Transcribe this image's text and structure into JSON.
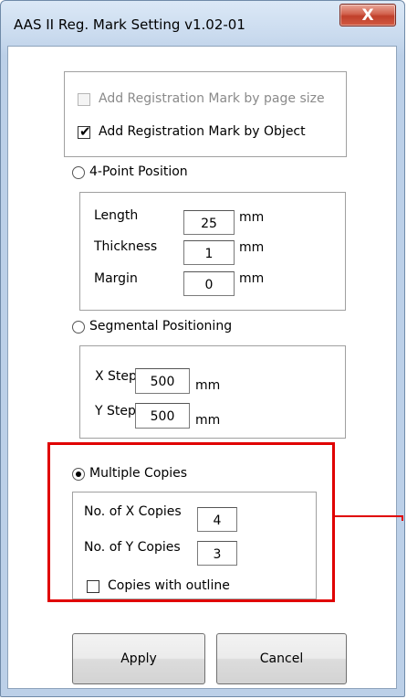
{
  "window": {
    "title": "AAS II Reg. Mark Setting v1.02-01",
    "close_glyph": "X",
    "close_icon": "close-icon"
  },
  "mark_options": {
    "by_page_size": {
      "label": "Add Registration Mark by page size",
      "checked": false,
      "enabled": false
    },
    "by_object": {
      "label": "Add Registration Mark by Object",
      "checked": true,
      "enabled": true
    }
  },
  "four_point": {
    "label": "4-Point Position",
    "selected": false,
    "fields": {
      "length": {
        "label": "Length",
        "value": "25",
        "unit": "mm"
      },
      "thickness": {
        "label": "Thickness",
        "value": "1",
        "unit": "mm"
      },
      "margin": {
        "label": "Margin",
        "value": "0",
        "unit": "mm"
      }
    }
  },
  "segmental": {
    "label": "Segmental Positioning",
    "selected": false,
    "fields": {
      "x_step": {
        "label": "X Step",
        "value": "500",
        "unit": "mm"
      },
      "y_step": {
        "label": "Y Step",
        "value": "500",
        "unit": "mm"
      }
    }
  },
  "multiple_copies": {
    "label": "Multiple Copies",
    "selected": true,
    "fields": {
      "x_copies": {
        "label": "No. of X Copies",
        "value": "4"
      },
      "y_copies": {
        "label": "No. of Y Copies",
        "value": "3"
      }
    },
    "outline": {
      "label": "Copies with outline",
      "checked": false
    }
  },
  "buttons": {
    "apply": "Apply",
    "cancel": "Cancel"
  },
  "colors": {
    "highlight": "#e00000",
    "close_button": "#c7432e"
  },
  "check_glyph": "✔"
}
